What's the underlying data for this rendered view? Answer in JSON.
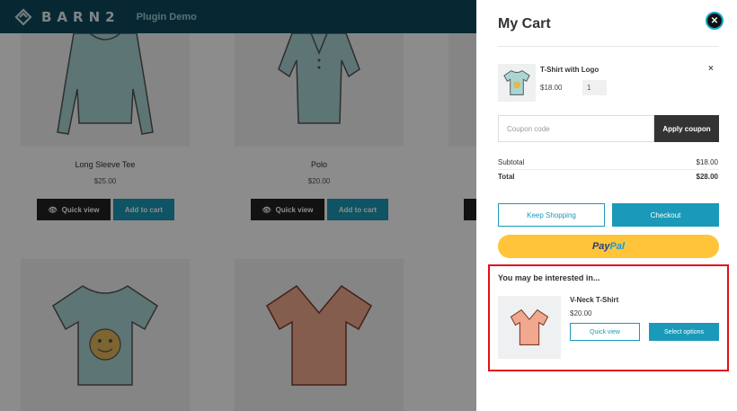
{
  "header": {
    "brand": "BARN2",
    "subtitle": "Plugin Demo",
    "bar_color": "#0d4a5c",
    "logo_icon": "barn2-logo-icon"
  },
  "products": [
    {
      "name": "Long Sleeve Tee",
      "price": "$25.00",
      "quick_view": "Quick view",
      "add_to_cart": "Add to cart",
      "image_icon": "long-sleeve-tee-icon"
    },
    {
      "name": "Polo",
      "price": "$20.00",
      "quick_view": "Quick view",
      "add_to_cart": "Add to cart",
      "image_icon": "polo-shirt-icon"
    },
    {
      "image_icon": "tshirt-with-logo-icon"
    },
    {
      "image_icon": "vneck-tshirt-icon"
    }
  ],
  "cart": {
    "title": "My Cart",
    "close_icon": "close-icon",
    "item": {
      "name": "T-Shirt with Logo",
      "price": "$18.00",
      "quantity": "1",
      "remove_symbol": "×"
    },
    "coupon": {
      "placeholder": "Coupon code",
      "apply_label": "Apply coupon"
    },
    "totals": {
      "subtotal_label": "Subtotal",
      "subtotal_value": "$18.00",
      "total_label": "Total",
      "total_value": "$28.00"
    },
    "keep_shopping_label": "Keep Shopping",
    "checkout_label": "Checkout",
    "paypal": {
      "pay": "Pay",
      "pal": "Pal"
    },
    "upsell": {
      "title": "You may be interested in...",
      "product_name": "V-Neck T-Shirt",
      "product_price": "$20.00",
      "quick_view_label": "Quick view",
      "select_options_label": "Select options"
    }
  },
  "colors": {
    "accent": "#1a9ab8",
    "paypal_yellow": "#ffc439",
    "highlight_border": "#e0101a"
  }
}
